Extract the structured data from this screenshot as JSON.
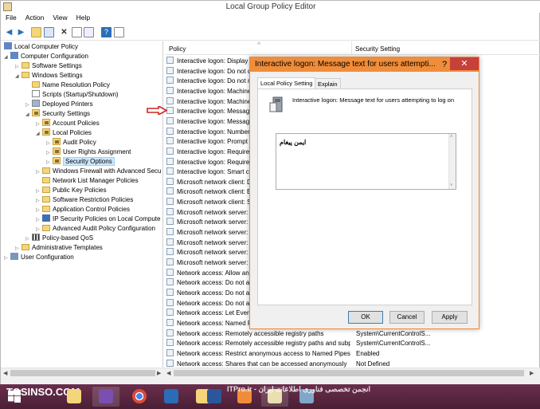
{
  "window": {
    "title": "Local Group Policy Editor"
  },
  "menu": [
    "File",
    "Action",
    "View",
    "Help"
  ],
  "toolbar": {
    "icons": [
      "back-icon",
      "forward-icon",
      "up-folder-icon",
      "show-hide-tree-icon",
      "delete-icon",
      "properties-icon",
      "export-icon",
      "help-icon",
      "view-icon"
    ]
  },
  "tree": {
    "items": [
      {
        "label": "Local Computer Policy",
        "icon": "computer-icon"
      },
      {
        "label": "Computer Configuration",
        "icon": "computer-icon"
      },
      {
        "label": "Software Settings",
        "icon": "folder-icon"
      },
      {
        "label": "Windows Settings",
        "icon": "folder-icon"
      },
      {
        "label": "Name Resolution Policy",
        "icon": "folder-icon"
      },
      {
        "label": "Scripts (Startup/Shutdown)",
        "icon": "script-icon"
      },
      {
        "label": "Deployed Printers",
        "icon": "printer-icon"
      },
      {
        "label": "Security Settings",
        "icon": "security-icon"
      },
      {
        "label": "Account Policies",
        "icon": "lock-folder-icon"
      },
      {
        "label": "Local Policies",
        "icon": "lock-folder-icon"
      },
      {
        "label": "Audit Policy",
        "icon": "lock-folder-icon"
      },
      {
        "label": "User Rights Assignment",
        "icon": "lock-folder-icon"
      },
      {
        "label": "Security Options",
        "icon": "lock-folder-icon"
      },
      {
        "label": "Windows Firewall with Advanced Secu",
        "icon": "folder-icon"
      },
      {
        "label": "Network List Manager Policies",
        "icon": "folder-icon"
      },
      {
        "label": "Public Key Policies",
        "icon": "folder-icon"
      },
      {
        "label": "Software Restriction Policies",
        "icon": "folder-icon"
      },
      {
        "label": "Application Control Policies",
        "icon": "folder-icon"
      },
      {
        "label": "IP Security Policies on Local Compute",
        "icon": "ipsec-icon"
      },
      {
        "label": "Advanced Audit Policy Configuration",
        "icon": "folder-icon"
      },
      {
        "label": "Policy-based QoS",
        "icon": "chart-icon"
      },
      {
        "label": "Administrative Templates",
        "icon": "folder-icon"
      },
      {
        "label": "User Configuration",
        "icon": "user-icon"
      }
    ]
  },
  "list": {
    "columns": [
      "Policy",
      "Security Setting"
    ],
    "rows": [
      {
        "policy": "Interactive logon: Display",
        "setting": ""
      },
      {
        "policy": "Interactive logon: Do not d",
        "setting": ""
      },
      {
        "policy": "Interactive logon: Do not r",
        "setting": ""
      },
      {
        "policy": "Interactive logon: Machine",
        "setting": ""
      },
      {
        "policy": "Interactive logon: Machine",
        "setting": ""
      },
      {
        "policy": "Interactive logon: Message",
        "setting": ""
      },
      {
        "policy": "Interactive logon: Message",
        "setting": ""
      },
      {
        "policy": "Interactive logon: Number",
        "setting": ""
      },
      {
        "policy": "Interactive logon: Prompt",
        "setting": ""
      },
      {
        "policy": "Interactive logon: Require",
        "setting": ""
      },
      {
        "policy": "Interactive logon: Require",
        "setting": ""
      },
      {
        "policy": "Interactive logon: Smart ca",
        "setting": ""
      },
      {
        "policy": "Microsoft network client: D",
        "setting": ""
      },
      {
        "policy": "Microsoft network client: E",
        "setting": ""
      },
      {
        "policy": "Microsoft network client: S",
        "setting": ""
      },
      {
        "policy": "Microsoft network server:",
        "setting": ""
      },
      {
        "policy": "Microsoft network server:",
        "setting": ""
      },
      {
        "policy": "Microsoft network server:",
        "setting": ""
      },
      {
        "policy": "Microsoft network server:",
        "setting": ""
      },
      {
        "policy": "Microsoft network server:",
        "setting": ""
      },
      {
        "policy": "Microsoft network server:",
        "setting": ""
      },
      {
        "policy": "Network access: Allow ano",
        "setting": ""
      },
      {
        "policy": "Network access: Do not all",
        "setting": ""
      },
      {
        "policy": "Network access: Do not all",
        "setting": ""
      },
      {
        "policy": "Network access: Do not all",
        "setting": ""
      },
      {
        "policy": "Network access: Let Everyo",
        "setting": ""
      },
      {
        "policy": "Network access: Named Pi",
        "setting": ""
      },
      {
        "policy": "Network access: Remotely accessible registry paths",
        "setting": "System\\CurrentControlS..."
      },
      {
        "policy": "Network access: Remotely accessible registry paths and subpaths",
        "setting": "System\\CurrentControlS..."
      },
      {
        "policy": "Network access: Restrict anonymous access to Named Pipes...",
        "setting": "Enabled"
      },
      {
        "policy": "Network access: Shares that can be accessed anonymously",
        "setting": "Not Defined"
      },
      {
        "policy": "Network access: Sharing and security model for local accou...",
        "setting": "Classic - local users auth..."
      }
    ]
  },
  "dialog": {
    "title": "Interactive logon: Message text for users attempti...",
    "help": "?",
    "close": "✕",
    "tabs": [
      "Local Policy Setting",
      "Explain"
    ],
    "policy_name": "Interactive logon: Message text for users attempting to log on",
    "text_value": "ایمن پیغام",
    "ok": "OK",
    "cancel": "Cancel",
    "apply": "Apply"
  },
  "taskbar": {
    "watermark_left": "TOSINSO.COM",
    "watermark_right": "ITPro.ir - انجمن تخصصی فناوری اطلاعات ایران",
    "apps": [
      "start-icon",
      "file-explorer-icon",
      "visual-studio-icon",
      "chrome-icon",
      "outlook-icon",
      "folder-icon",
      "word-icon",
      "fox-icon",
      "notepad-icon",
      "app-icon"
    ]
  }
}
